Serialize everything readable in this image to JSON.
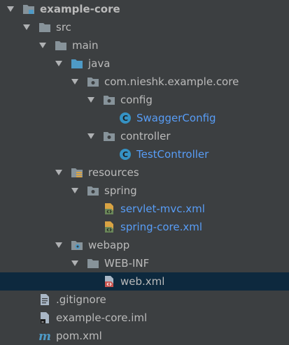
{
  "tree": {
    "root": {
      "label": "example-core"
    },
    "src": {
      "label": "src"
    },
    "main": {
      "label": "main"
    },
    "java": {
      "label": "java"
    },
    "package": {
      "label": "com.nieshk.example.core"
    },
    "config": {
      "label": "config"
    },
    "swagger_config": {
      "label": "SwaggerConfig",
      "icon": "class-icon"
    },
    "controller": {
      "label": "controller"
    },
    "test_controller": {
      "label": "TestController",
      "icon": "class-icon"
    },
    "resources": {
      "label": "resources"
    },
    "spring": {
      "label": "spring"
    },
    "servlet_mvc": {
      "label": "servlet-mvc.xml",
      "icon": "spring-xml-icon"
    },
    "spring_core": {
      "label": "spring-core.xml",
      "icon": "spring-xml-icon"
    },
    "webapp": {
      "label": "webapp"
    },
    "web_inf": {
      "label": "WEB-INF"
    },
    "web_xml": {
      "label": "web.xml",
      "icon": "xml-file-icon",
      "selected": true
    },
    "gitignore": {
      "label": ".gitignore",
      "icon": "text-file-icon"
    },
    "iml": {
      "label": "example-core.iml",
      "icon": "iml-file-icon"
    },
    "pom": {
      "label": "pom.xml",
      "icon": "maven-icon"
    }
  },
  "colors": {
    "background": "#3c3f41",
    "text": "#bbbbbb",
    "link_text": "#589df6",
    "selection": "#0d293e",
    "folder": "#87939a",
    "source_folder": "#4e9ac6",
    "class_badge": "#3592c4"
  }
}
